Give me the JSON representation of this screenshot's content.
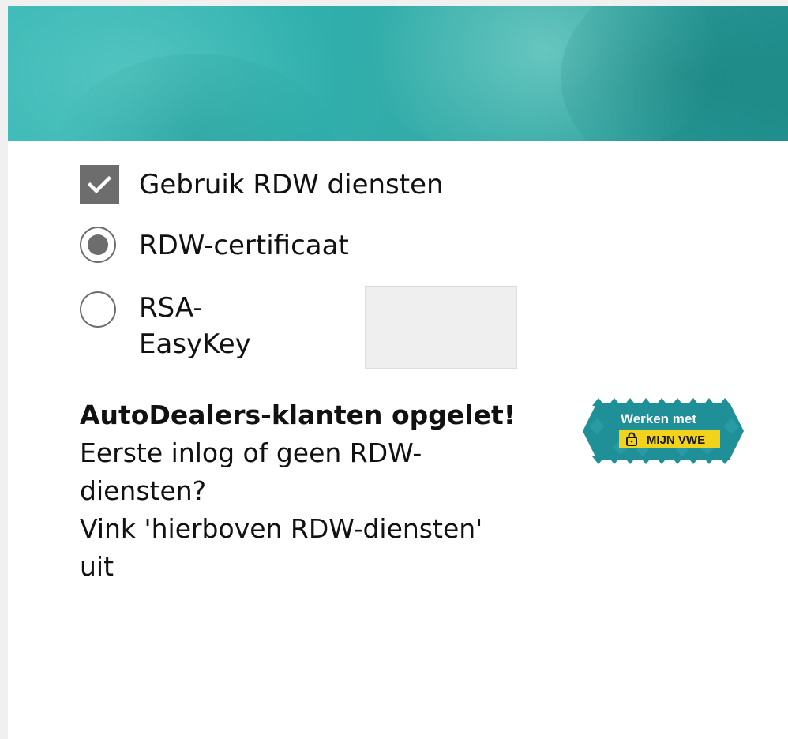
{
  "options": {
    "use_rdw_label": "Gebruik RDW diensten",
    "use_rdw_checked": true,
    "rdw_cert_label": "RDW-certificaat",
    "rdw_cert_selected": true,
    "rsa_label": "RSA-EasyKey",
    "rsa_selected": false,
    "easykey_value": ""
  },
  "notice": {
    "title": "AutoDealers-klanten opgelet!",
    "line1": "Eerste inlog of geen RDW-diensten?",
    "line2": "Vink 'hierboven RDW-diensten' uit"
  },
  "badge": {
    "line1": "Werken met",
    "line2": "MIJN VWE",
    "colors": {
      "teal": "#1f8f98",
      "yellow": "#f2d21b"
    }
  },
  "colors": {
    "hero_teal": "#2fb0ad",
    "control_gray": "#6d6d6d"
  }
}
